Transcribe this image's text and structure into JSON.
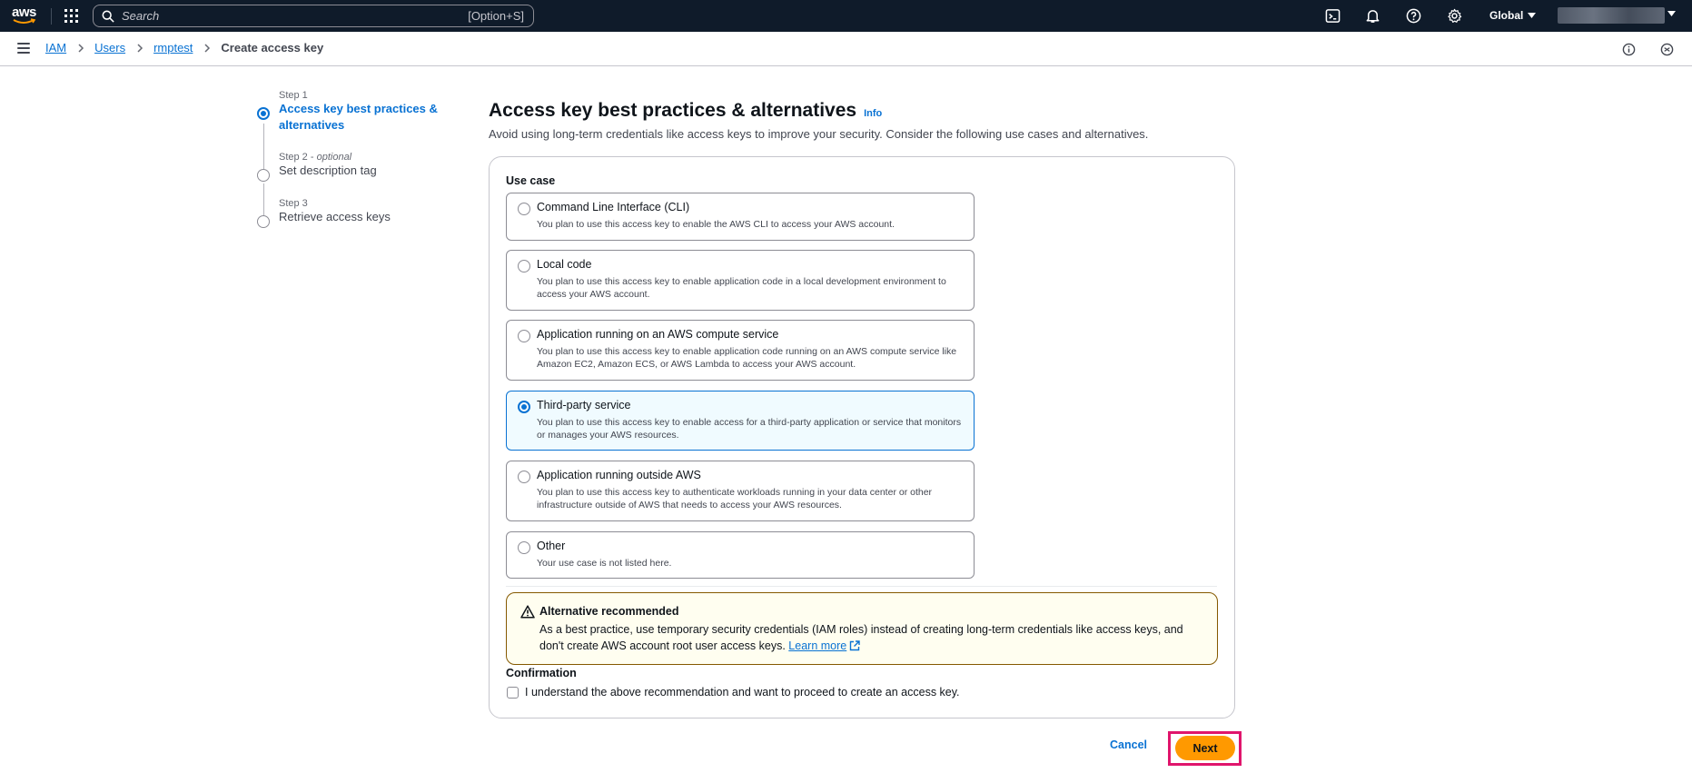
{
  "app": {
    "logo_text": "aws"
  },
  "topnav": {
    "search_placeholder": "Search",
    "search_shortcut": "[Option+S]",
    "region": "Global",
    "icons": [
      "cloudshell-icon",
      "bell-icon",
      "help-icon",
      "settings-icon"
    ]
  },
  "breadcrumb": {
    "items": [
      "IAM",
      "Users",
      "rmptest"
    ],
    "current": "Create access key"
  },
  "steps": [
    {
      "num": "Step 1",
      "optional": "",
      "title": "Access key best practices & alternatives",
      "active": true
    },
    {
      "num": "Step 2",
      "optional": "optional",
      "title": "Set description tag",
      "active": false
    },
    {
      "num": "Step 3",
      "optional": "",
      "title": "Retrieve access keys",
      "active": false
    }
  ],
  "page": {
    "title": "Access key best practices & alternatives",
    "info": "Info",
    "subtitle": "Avoid using long-term credentials like access keys to improve your security. Consider the following use cases and alternatives."
  },
  "use_case": {
    "label": "Use case",
    "options": [
      {
        "title": "Command Line Interface (CLI)",
        "desc": "You plan to use this access key to enable the AWS CLI to access your AWS account.",
        "selected": false
      },
      {
        "title": "Local code",
        "desc": "You plan to use this access key to enable application code in a local development environment to access your AWS account.",
        "selected": false
      },
      {
        "title": "Application running on an AWS compute service",
        "desc": "You plan to use this access key to enable application code running on an AWS compute service like Amazon EC2, Amazon ECS, or AWS Lambda to access your AWS account.",
        "selected": false
      },
      {
        "title": "Third-party service",
        "desc": "You plan to use this access key to enable access for a third-party application or service that monitors or manages your AWS resources.",
        "selected": true
      },
      {
        "title": "Application running outside AWS",
        "desc": "You plan to use this access key to authenticate workloads running in your data center or other infrastructure outside of AWS that needs to access your AWS resources.",
        "selected": false
      },
      {
        "title": "Other",
        "desc": "Your use case is not listed here.",
        "selected": false
      }
    ]
  },
  "alert": {
    "title": "Alternative recommended",
    "body": "As a best practice, use temporary security credentials (IAM roles) instead of creating long-term credentials like access keys, and don't create AWS account root user access keys.",
    "link": "Learn more"
  },
  "confirmation": {
    "label": "Confirmation",
    "text": "I understand the above recommendation and want to proceed to create an access key.",
    "checked": false
  },
  "actions": {
    "cancel": "Cancel",
    "next": "Next"
  },
  "colors": {
    "nav_bg": "#0f1b2a",
    "link": "#0972d3",
    "primary_button": "#ff9900",
    "highlight_frame": "#e0156c",
    "alert_border": "#855900"
  }
}
